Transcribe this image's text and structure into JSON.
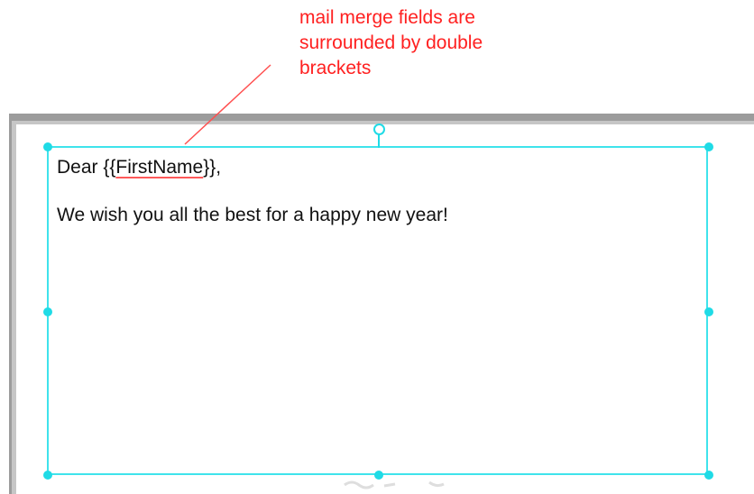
{
  "annotation": {
    "lines": [
      "mail merge fields are",
      "surrounded by double",
      "brackets"
    ],
    "color": "#ff2020"
  },
  "letter": {
    "greeting_prefix": "Dear ",
    "open_brackets": "{{",
    "merge_field": "FirstName",
    "close_brackets": "}},",
    "body": "We wish you all the best for a happy new year!"
  },
  "selection": {
    "color": "#3fe3ec",
    "handles": [
      "top-left",
      "top-right",
      "middle-left",
      "middle-right",
      "bottom-left",
      "bottom-center",
      "bottom-right"
    ]
  }
}
